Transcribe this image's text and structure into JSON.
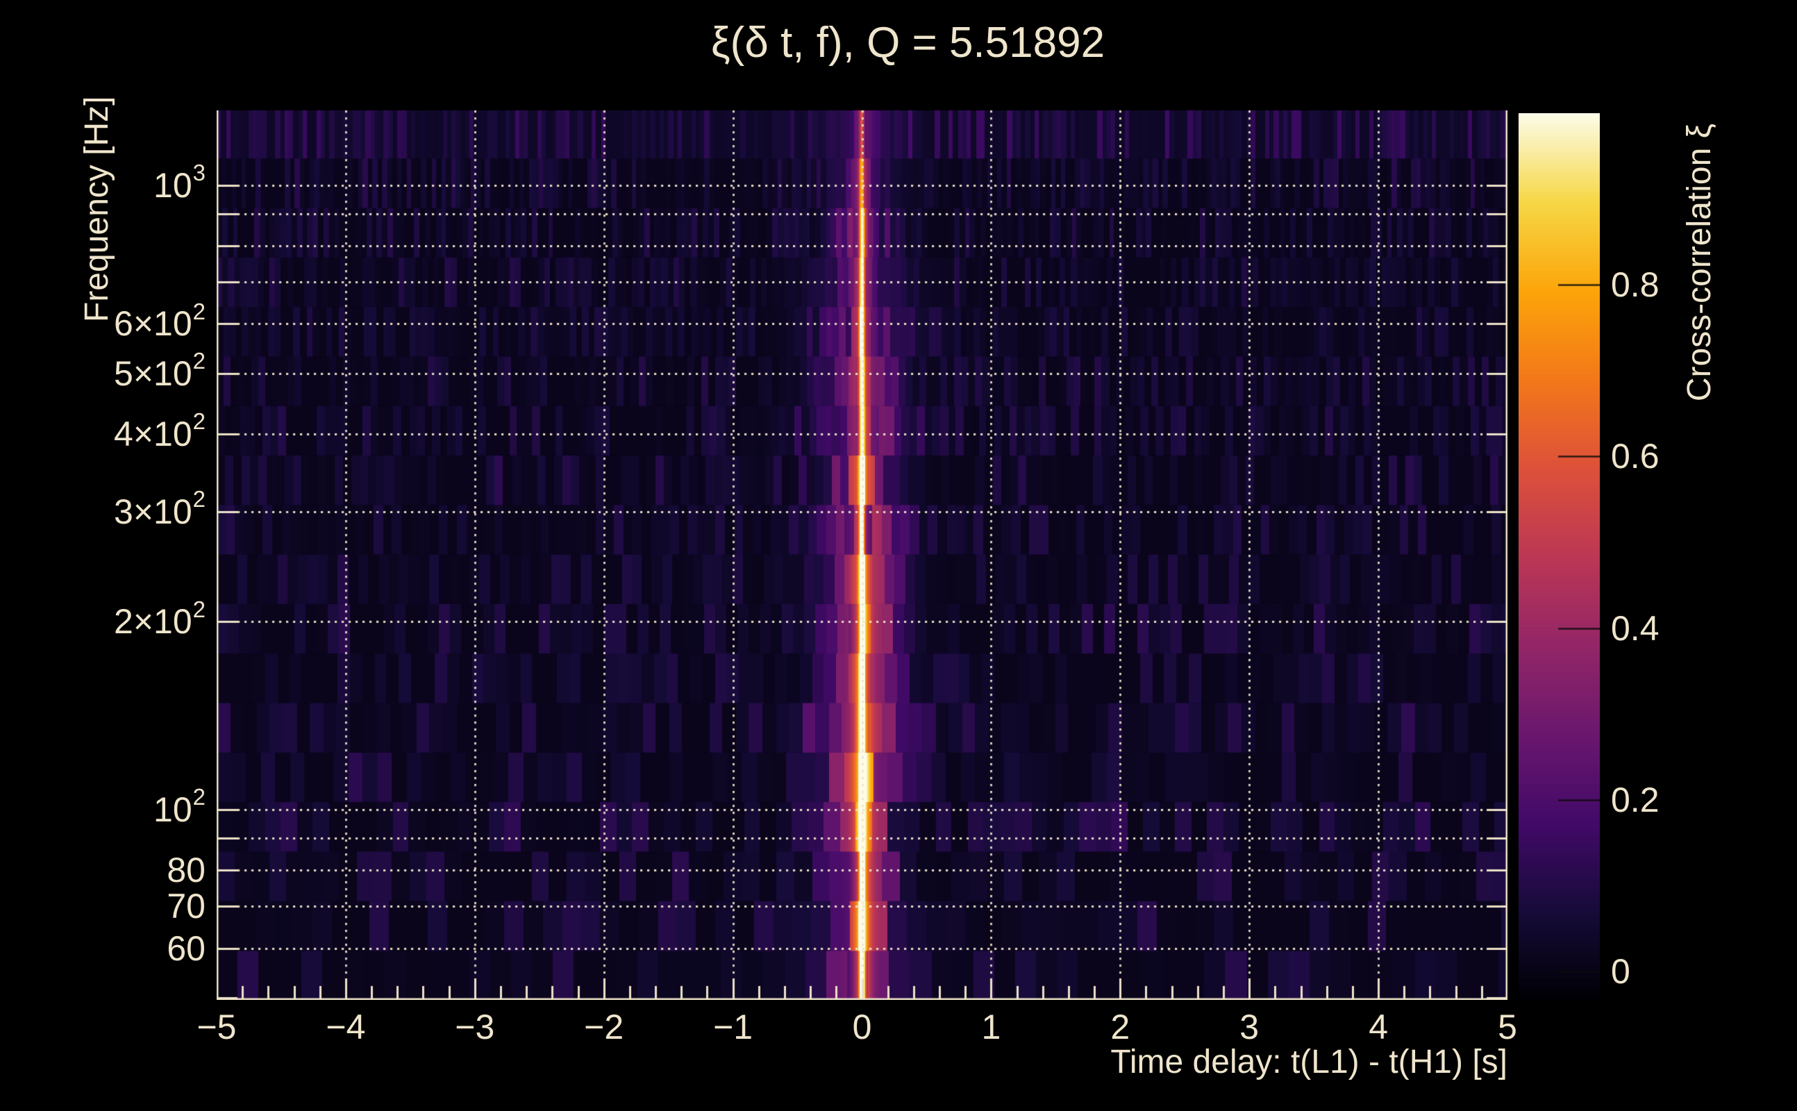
{
  "title": "ξ(δ t, f), Q = 5.51892",
  "x_axis": {
    "label": "Time delay: t(L1) - t(H1) [s]",
    "min": -5,
    "max": 5,
    "major_tick_step": 1,
    "minor_tick_step": 0.2,
    "ticks": [
      {
        "v": -5,
        "label": "−5"
      },
      {
        "v": -4,
        "label": "−4"
      },
      {
        "v": -3,
        "label": "−3"
      },
      {
        "v": -2,
        "label": "−2"
      },
      {
        "v": -1,
        "label": "−1"
      },
      {
        "v": 0,
        "label": "0"
      },
      {
        "v": 1,
        "label": "1"
      },
      {
        "v": 2,
        "label": "2"
      },
      {
        "v": 3,
        "label": "3"
      },
      {
        "v": 4,
        "label": "4"
      },
      {
        "v": 5,
        "label": "5"
      }
    ]
  },
  "y_axis": {
    "label": "Frequency [Hz]",
    "scale": "log",
    "min_hz": 49.6,
    "max_hz": 1318,
    "gridline_hz": [
      1000,
      900,
      800,
      700,
      600,
      500,
      400,
      300,
      200,
      100,
      90,
      80,
      70,
      60
    ],
    "extra_tick_hz": [
      50
    ],
    "tick_labels": [
      {
        "hz": 1000,
        "parts": [
          {
            "t": "10"
          },
          {
            "t": "3",
            "sup": true
          }
        ]
      },
      {
        "hz": 600,
        "parts": [
          {
            "t": "6×10"
          },
          {
            "t": "2",
            "sup": true
          }
        ]
      },
      {
        "hz": 500,
        "parts": [
          {
            "t": "5×10"
          },
          {
            "t": "2",
            "sup": true
          }
        ]
      },
      {
        "hz": 400,
        "parts": [
          {
            "t": "4×10"
          },
          {
            "t": "2",
            "sup": true
          }
        ]
      },
      {
        "hz": 300,
        "parts": [
          {
            "t": "3×10"
          },
          {
            "t": "2",
            "sup": true
          }
        ]
      },
      {
        "hz": 200,
        "parts": [
          {
            "t": "2×10"
          },
          {
            "t": "2",
            "sup": true
          }
        ]
      },
      {
        "hz": 100,
        "parts": [
          {
            "t": "10"
          },
          {
            "t": "2",
            "sup": true
          }
        ]
      },
      {
        "hz": 80,
        "parts": [
          {
            "t": "80"
          }
        ]
      },
      {
        "hz": 70,
        "parts": [
          {
            "t": "70"
          }
        ]
      },
      {
        "hz": 60,
        "parts": [
          {
            "t": "60"
          }
        ]
      }
    ]
  },
  "colorbar": {
    "label": "Cross-correlation ξ",
    "vmin": -0.033,
    "vmax": 1.0,
    "ticks": [
      {
        "v": 0.8,
        "label": "0.8"
      },
      {
        "v": 0.6,
        "label": "0.6"
      },
      {
        "v": 0.4,
        "label": "0.4"
      },
      {
        "v": 0.2,
        "label": "0.2"
      },
      {
        "v": 0.0,
        "label": "0"
      }
    ]
  },
  "chart_data": {
    "type": "heatmap",
    "title": "ξ(δ t, f), Q = 5.51892",
    "q_value": 5.51892,
    "xlabel": "Time delay: t(L1) - t(H1) [s]",
    "ylabel": "Frequency [Hz]",
    "zlabel": "Cross-correlation ξ",
    "x_range_s": [
      -5,
      5
    ],
    "y_range_hz": [
      49.6,
      1318
    ],
    "y_scale": "log",
    "z_range": [
      -0.033,
      1.0
    ],
    "peak": {
      "time_delay_s": 0.0,
      "value": 1.0
    },
    "ridge": {
      "t0_s": 0.0,
      "core_sigma_s": 0.014,
      "halo_sigma_s": 0.05
    },
    "grid": {
      "x_gridlines": [
        -5,
        -4,
        -3,
        -2,
        -1,
        0,
        1,
        2,
        3,
        4,
        5
      ],
      "style": "dotted",
      "color": "#efe5cc"
    },
    "rows": [
      {
        "f_lo": 49.6,
        "f_hi": 59.5,
        "wing_w": 0.32,
        "wing_a": 0.26,
        "core_a": 0.96,
        "noise_amp": 0.05,
        "noise_floor": 0.012
      },
      {
        "f_lo": 59.5,
        "f_hi": 71.5,
        "wing_w": 0.26,
        "wing_a": 0.34,
        "core_a": 1.0,
        "noise_amp": 0.05,
        "noise_floor": 0.012
      },
      {
        "f_lo": 71.5,
        "f_hi": 85.8,
        "wing_w": 0.22,
        "wing_a": 0.3,
        "core_a": 1.0,
        "noise_amp": 0.05,
        "noise_floor": 0.012
      },
      {
        "f_lo": 85.8,
        "f_hi": 103.0,
        "wing_w": 0.2,
        "wing_a": 0.42,
        "core_a": 1.0,
        "noise_amp": 0.06,
        "noise_floor": 0.012
      },
      {
        "f_lo": 103.0,
        "f_hi": 123.6,
        "wing_w": 0.26,
        "wing_a": 0.38,
        "core_a": 0.98,
        "noise_amp": 0.05,
        "noise_floor": 0.012
      },
      {
        "f_lo": 123.6,
        "f_hi": 148.4,
        "wing_w": 0.3,
        "wing_a": 0.42,
        "core_a": 0.96,
        "noise_amp": 0.05,
        "noise_floor": 0.012
      },
      {
        "f_lo": 148.4,
        "f_hi": 178.1,
        "wing_w": 0.24,
        "wing_a": 0.34,
        "core_a": 0.94,
        "noise_amp": 0.04,
        "noise_floor": 0.012
      },
      {
        "f_lo": 178.1,
        "f_hi": 213.8,
        "wing_w": 0.28,
        "wing_a": 0.32,
        "core_a": 0.92,
        "noise_amp": 0.05,
        "noise_floor": 0.012
      },
      {
        "f_lo": 213.8,
        "f_hi": 256.6,
        "wing_w": 0.24,
        "wing_a": 0.36,
        "core_a": 0.9,
        "noise_amp": 0.04,
        "noise_floor": 0.012
      },
      {
        "f_lo": 256.6,
        "f_hi": 308.0,
        "wing_w": 0.28,
        "wing_a": 0.3,
        "core_a": 0.88,
        "noise_amp": 0.04,
        "noise_floor": 0.012
      },
      {
        "f_lo": 308.0,
        "f_hi": 369.7,
        "wing_w": 0.2,
        "wing_a": 0.46,
        "core_a": 0.86,
        "noise_amp": 0.05,
        "noise_floor": 0.012
      },
      {
        "f_lo": 369.7,
        "f_hi": 443.7,
        "wing_w": 0.33,
        "wing_a": 0.24,
        "core_a": 0.82,
        "noise_amp": 0.04,
        "noise_floor": 0.012
      },
      {
        "f_lo": 443.7,
        "f_hi": 532.5,
        "wing_w": 0.25,
        "wing_a": 0.3,
        "core_a": 0.8,
        "noise_amp": 0.04,
        "noise_floor": 0.012
      },
      {
        "f_lo": 532.5,
        "f_hi": 639.2,
        "wing_w": 0.3,
        "wing_a": 0.22,
        "core_a": 0.78,
        "noise_amp": 0.035,
        "noise_floor": 0.012
      },
      {
        "f_lo": 639.2,
        "f_hi": 767.2,
        "wing_w": 0.3,
        "wing_a": 0.17,
        "core_a": 0.74,
        "noise_amp": 0.04,
        "noise_floor": 0.012
      },
      {
        "f_lo": 767.2,
        "f_hi": 920.8,
        "wing_w": 0.2,
        "wing_a": 0.22,
        "core_a": 0.72,
        "noise_amp": 0.04,
        "noise_floor": 0.012
      },
      {
        "f_lo": 920.8,
        "f_hi": 1105.2,
        "wing_w": 0.22,
        "wing_a": 0.15,
        "core_a": 0.62,
        "noise_amp": 0.045,
        "noise_floor": 0.014
      },
      {
        "f_lo": 1105.2,
        "f_hi": 1318.0,
        "wing_w": 0.26,
        "wing_a": 0.13,
        "core_a": 0.35,
        "noise_amp": 0.06,
        "noise_floor": 0.035
      }
    ],
    "noise_seed": 11,
    "colormap": {
      "name": "inferno",
      "stops": [
        [
          0.0,
          [
            0,
            0,
            4
          ]
        ],
        [
          0.1,
          [
            22,
            11,
            57
          ]
        ],
        [
          0.2,
          [
            66,
            10,
            104
          ]
        ],
        [
          0.3,
          [
            106,
            23,
            110
          ]
        ],
        [
          0.4,
          [
            147,
            38,
            103
          ]
        ],
        [
          0.5,
          [
            188,
            55,
            84
          ]
        ],
        [
          0.6,
          [
            221,
            81,
            58
          ]
        ],
        [
          0.7,
          [
            243,
            120,
            25
          ]
        ],
        [
          0.8,
          [
            252,
            165,
            10
          ]
        ],
        [
          0.9,
          [
            246,
            215,
            70
          ]
        ],
        [
          1.0,
          [
            252,
            252,
            233
          ]
        ]
      ]
    }
  },
  "style": {
    "background": "#000000",
    "text_color": "#efe5cc",
    "grid_color": "#efe5cc",
    "spine_color": "#ece2c8"
  }
}
